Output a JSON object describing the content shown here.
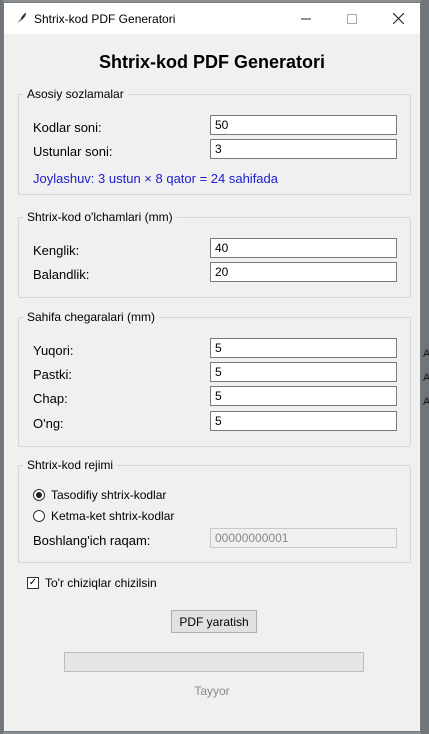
{
  "window": {
    "title": "Shtrix-kod PDF Generatori"
  },
  "heading": "Shtrix-kod PDF Generatori",
  "basic": {
    "legend": "Asosiy sozlamalar",
    "count_label": "Kodlar soni:",
    "count_value": "50",
    "columns_label": "Ustunlar soni:",
    "columns_value": "3",
    "layout_info": "Joylashuv: 3 ustun × 8 qator = 24 sahifada"
  },
  "size": {
    "legend": "Shtrix-kod o'lchamlari (mm)",
    "width_label": "Kenglik:",
    "width_value": "40",
    "height_label": "Balandlik:",
    "height_value": "20"
  },
  "margins": {
    "legend": "Sahifa chegaralari (mm)",
    "top_label": "Yuqori:",
    "top_value": "5",
    "bottom_label": "Pastki:",
    "bottom_value": "5",
    "left_label": "Chap:",
    "left_value": "5",
    "right_label": "O'ng:",
    "right_value": "5"
  },
  "mode": {
    "legend": "Shtrix-kod rejimi",
    "random_label": "Tasodifiy shtrix-kodlar",
    "sequential_label": "Ketma-ket shtrix-kodlar",
    "selected": "random",
    "start_label": "Boshlang'ich raqam:",
    "start_value": "00000000001"
  },
  "grid_lines": {
    "label": "To'r chiziqlar chizilsin",
    "checked": true
  },
  "generate_button": "PDF yaratish",
  "progress": {
    "fraction": 0
  },
  "status": "Tayyor",
  "icons": {
    "app": "feather-icon",
    "minimize": "minimize-icon",
    "maximize": "maximize-icon",
    "close": "close-icon"
  }
}
